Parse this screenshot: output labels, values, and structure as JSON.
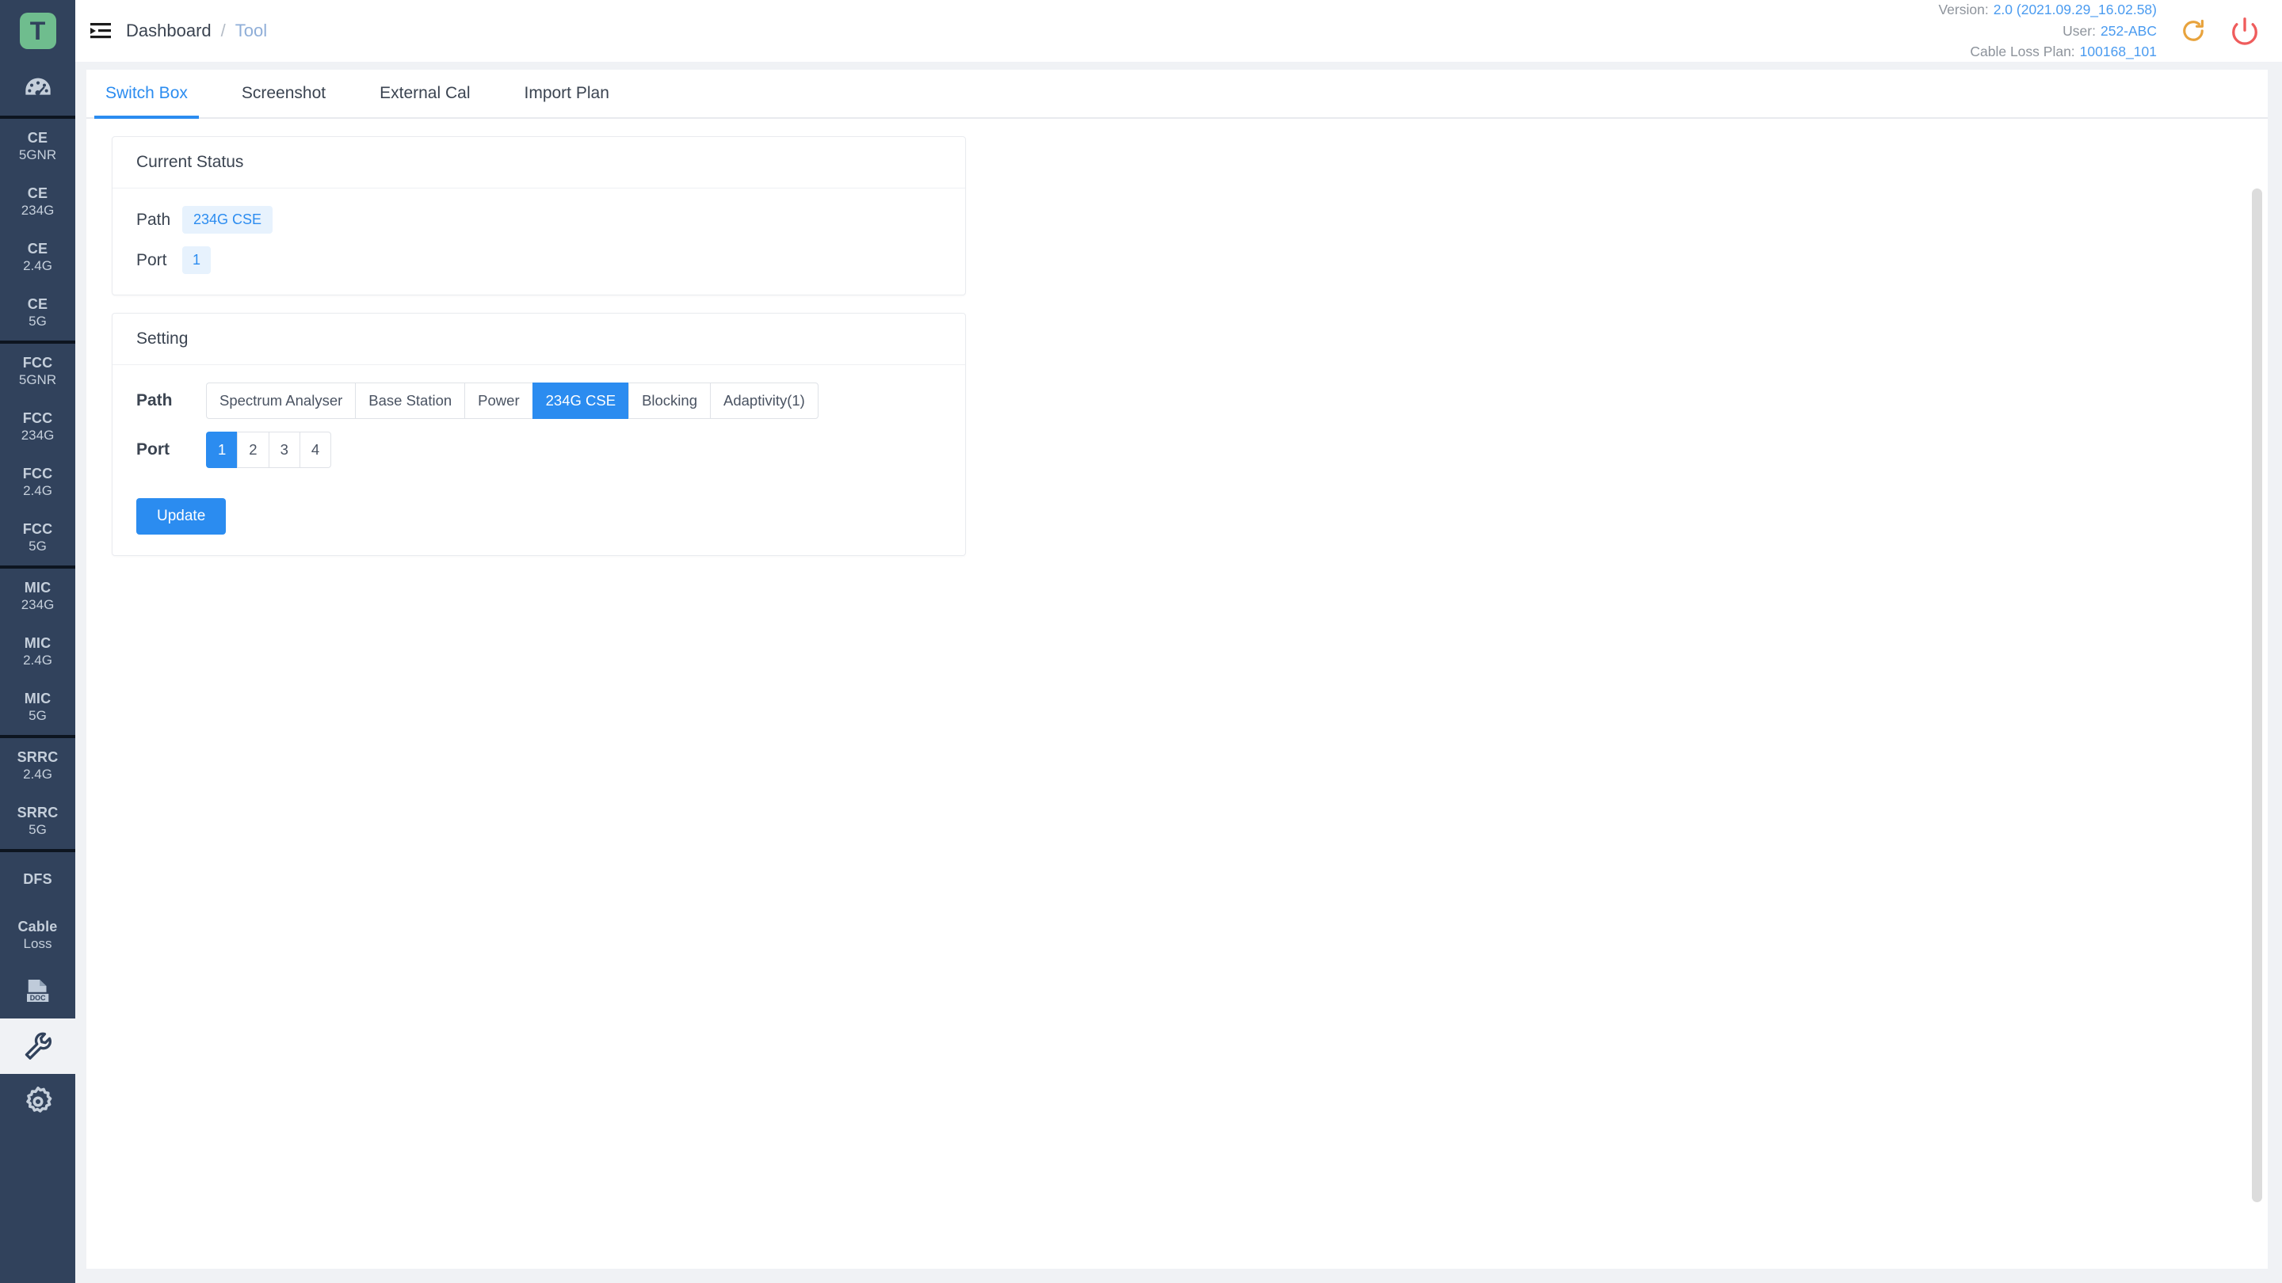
{
  "app": {
    "logo_letter": "T",
    "accent_blue": "#2b8cf0",
    "sidebar_bg": "#31425c",
    "logo_green": "#6fbd8e",
    "refresh_color": "#e8a33d",
    "power_color": "#ef5c5c"
  },
  "sidebar": {
    "logo_icon": "logo-t-icon",
    "dashboard_icon": "dashboard-gauge-icon",
    "groups": [
      {
        "name": "ce",
        "items": [
          {
            "l1": "CE",
            "l2": "5GNR"
          },
          {
            "l1": "CE",
            "l2": "234G"
          },
          {
            "l1": "CE",
            "l2": "2.4G"
          },
          {
            "l1": "CE",
            "l2": "5G"
          }
        ]
      },
      {
        "name": "fcc",
        "items": [
          {
            "l1": "FCC",
            "l2": "5GNR"
          },
          {
            "l1": "FCC",
            "l2": "234G"
          },
          {
            "l1": "FCC",
            "l2": "2.4G"
          },
          {
            "l1": "FCC",
            "l2": "5G"
          }
        ]
      },
      {
        "name": "mic",
        "items": [
          {
            "l1": "MIC",
            "l2": "234G"
          },
          {
            "l1": "MIC",
            "l2": "2.4G"
          },
          {
            "l1": "MIC",
            "l2": "5G"
          }
        ]
      },
      {
        "name": "srrc",
        "items": [
          {
            "l1": "SRRC",
            "l2": "2.4G"
          },
          {
            "l1": "SRRC",
            "l2": "5G"
          }
        ]
      },
      {
        "name": "misc",
        "items": [
          {
            "l1": "DFS",
            "l2": ""
          },
          {
            "l1": "Cable",
            "l2": "Loss"
          }
        ]
      }
    ],
    "icon_items": [
      {
        "icon": "doc-icon",
        "active": false
      },
      {
        "icon": "wrench-tool-icon",
        "active": true
      },
      {
        "icon": "gear-settings-icon",
        "active": false
      }
    ]
  },
  "topbar": {
    "menu_icon": "menu-unfold-icon",
    "breadcrumb": {
      "root": "Dashboard",
      "separator": "/",
      "current": "Tool"
    },
    "meta": [
      {
        "key": "Version:",
        "value": "2.0 (2021.09.29_16.02.58)"
      },
      {
        "key": "User:",
        "value": "252-ABC"
      },
      {
        "key": "Cable Loss Plan:",
        "value": "100168_101"
      }
    ],
    "refresh_icon": "refresh-icon",
    "power_icon": "power-icon"
  },
  "tabs": [
    {
      "label": "Switch Box",
      "active": true
    },
    {
      "label": "Screenshot",
      "active": false
    },
    {
      "label": "External Cal",
      "active": false
    },
    {
      "label": "Import Plan",
      "active": false
    }
  ],
  "current_status": {
    "title": "Current Status",
    "path_label": "Path",
    "path_value": "234G CSE",
    "port_label": "Port",
    "port_value": "1"
  },
  "setting": {
    "title": "Setting",
    "path_label": "Path",
    "path_options": [
      {
        "label": "Spectrum Analyser",
        "selected": false
      },
      {
        "label": "Base Station",
        "selected": false
      },
      {
        "label": "Power",
        "selected": false
      },
      {
        "label": "234G CSE",
        "selected": true
      },
      {
        "label": "Blocking",
        "selected": false
      },
      {
        "label": "Adaptivity(1)",
        "selected": false
      }
    ],
    "port_label": "Port",
    "port_options": [
      {
        "label": "1",
        "selected": true
      },
      {
        "label": "2",
        "selected": false
      },
      {
        "label": "3",
        "selected": false
      },
      {
        "label": "4",
        "selected": false
      }
    ],
    "update_label": "Update"
  }
}
